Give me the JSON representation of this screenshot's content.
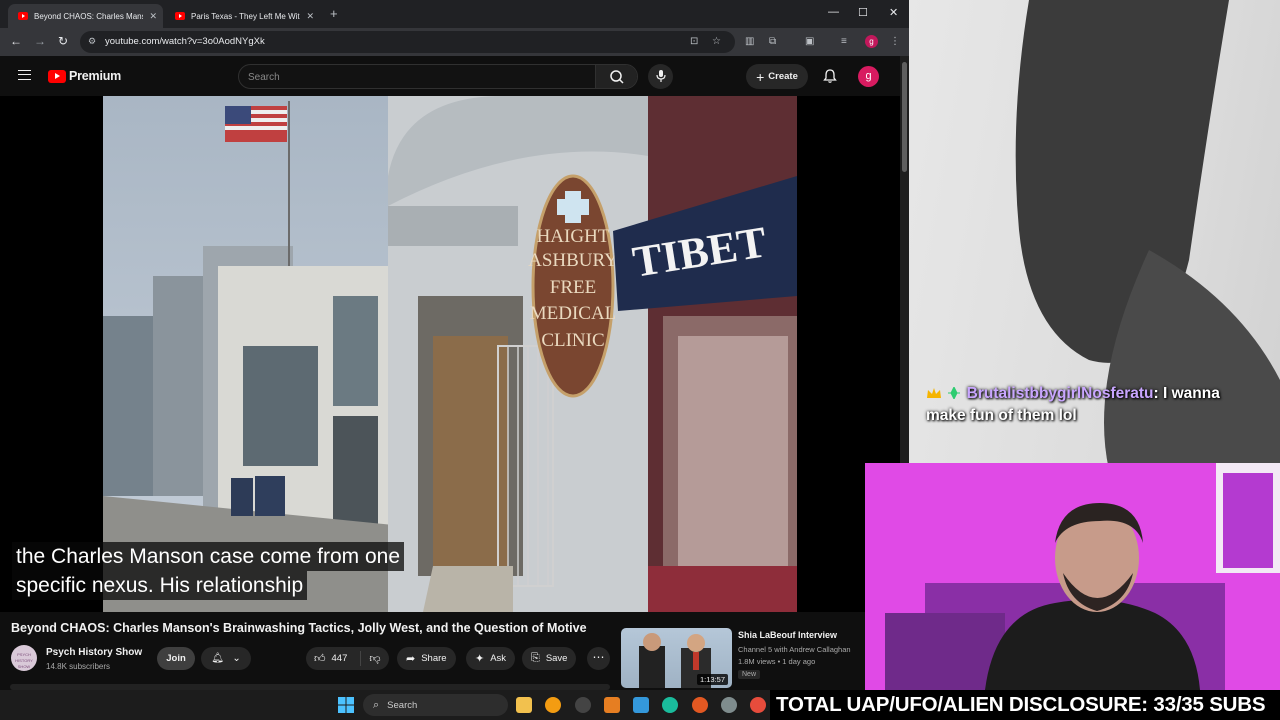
{
  "browser": {
    "tabs": [
      {
        "title": "Beyond CHAOS: Charles Manso",
        "active": true
      },
      {
        "title": "Paris Texas - They Left Me With",
        "active": false
      }
    ],
    "url": "youtube.com/watch?v=3o0AodNYgXk",
    "profile_initial": "g"
  },
  "youtube": {
    "logo_text": "Premium",
    "search_placeholder": "Search",
    "create_label": "Create",
    "avatar_initial": "g"
  },
  "video": {
    "caption_line1": "the Charles Manson case come from one",
    "caption_line2": "specific nexus. His relationship",
    "sign_clinic": [
      "HAIGHT",
      "ASHBURY",
      "FREE",
      "MEDICAL",
      "CLINIC"
    ],
    "sign_store": "TIBET",
    "title": "Beyond CHAOS: Charles Manson's Brainwashing Tactics, Jolly West, and the Question of Motive",
    "channel_name": "Psych History Show",
    "channel_subs": "14.8K subscribers",
    "channel_avatar_text": "PSYCH HISTORY SHOW",
    "join_label": "Join",
    "likes": "447",
    "share_label": "Share",
    "ask_label": "Ask",
    "save_label": "Save"
  },
  "recommended": {
    "title": "Shia LaBeouf Interview",
    "channel": "Channel 5 with Andrew Callaghan",
    "meta": "1.8M views • 1 day ago",
    "badge": "New",
    "duration": "1:13:57"
  },
  "stream": {
    "chat_user": "BrutalistbbygirlNosferatu",
    "chat_message": "I wanna make fun of them lol",
    "banner": "TOTAL UAP/UFO/ALIEN DISCLOSURE: 33/35 SUBS"
  },
  "taskbar": {
    "search_label": "Search"
  }
}
